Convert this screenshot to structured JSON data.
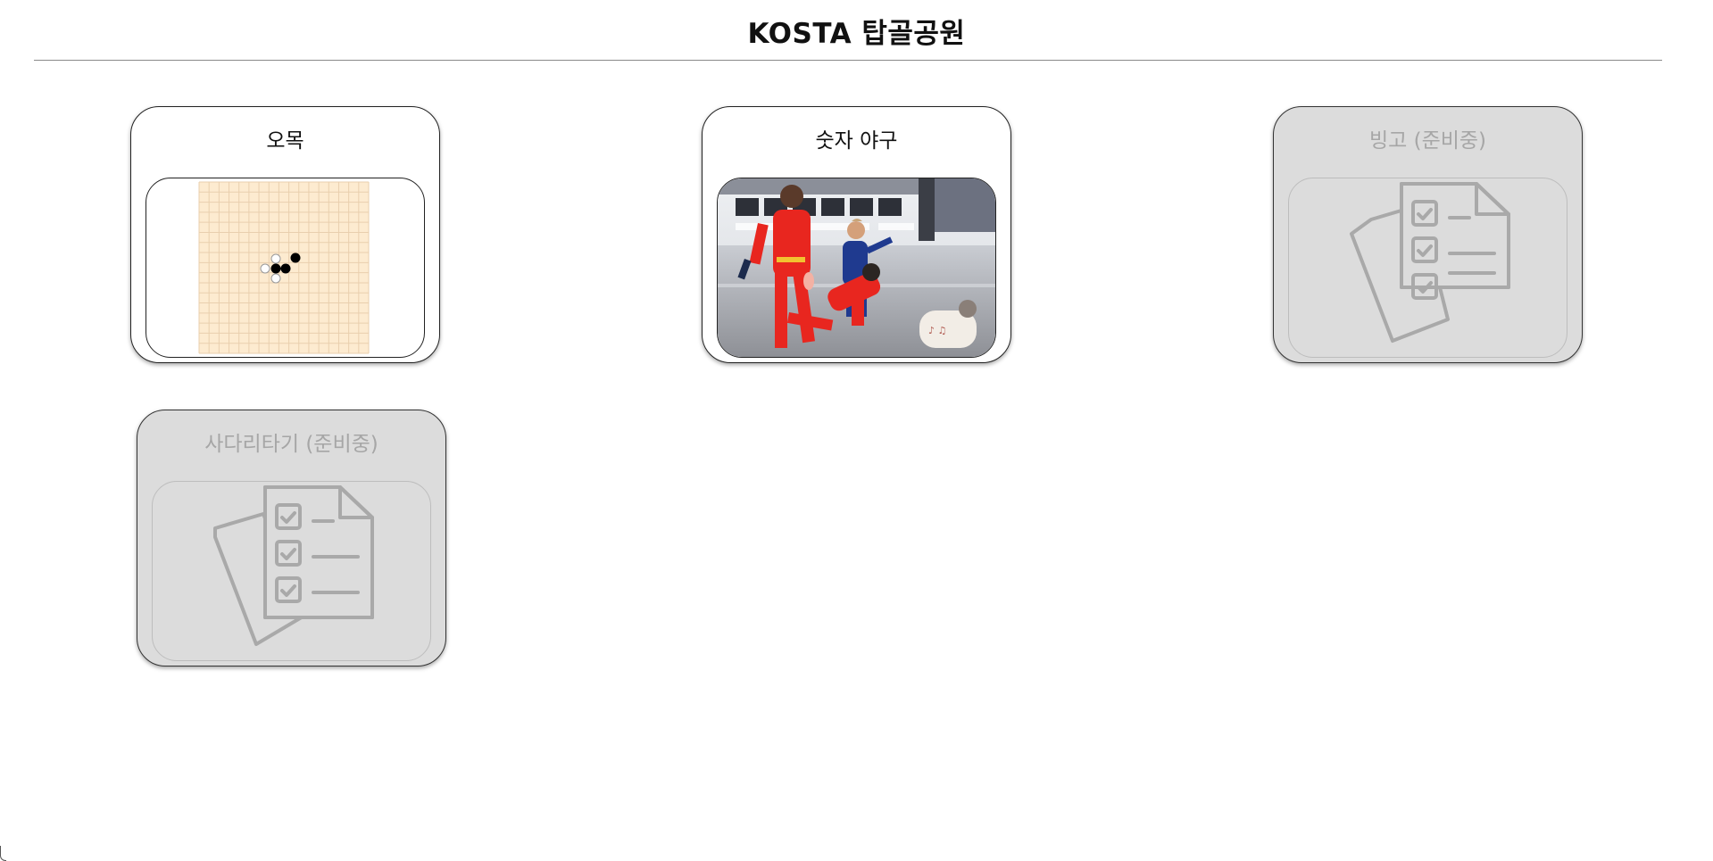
{
  "header": {
    "title": "KOSTA 탑골공원"
  },
  "games": [
    {
      "title": "오목",
      "status": "available",
      "thumbnail_icon": "gomoku-board-icon"
    },
    {
      "title": "숫자 야구",
      "status": "available",
      "thumbnail_icon": "number-baseball-photo"
    },
    {
      "title": "빙고 (준비중)",
      "status": "coming-soon",
      "thumbnail_icon": "checklist-document-icon"
    },
    {
      "title": "사다리타기 (준비중)",
      "status": "coming-soon",
      "thumbnail_icon": "checklist-document-icon"
    }
  ],
  "colors": {
    "board": "#fdebd0",
    "disabled_card": "#dcdcdc",
    "disabled_text": "#a6a6a6",
    "photo_suit_red": "#e8261f",
    "photo_suit_blue": "#1f3a8f"
  }
}
